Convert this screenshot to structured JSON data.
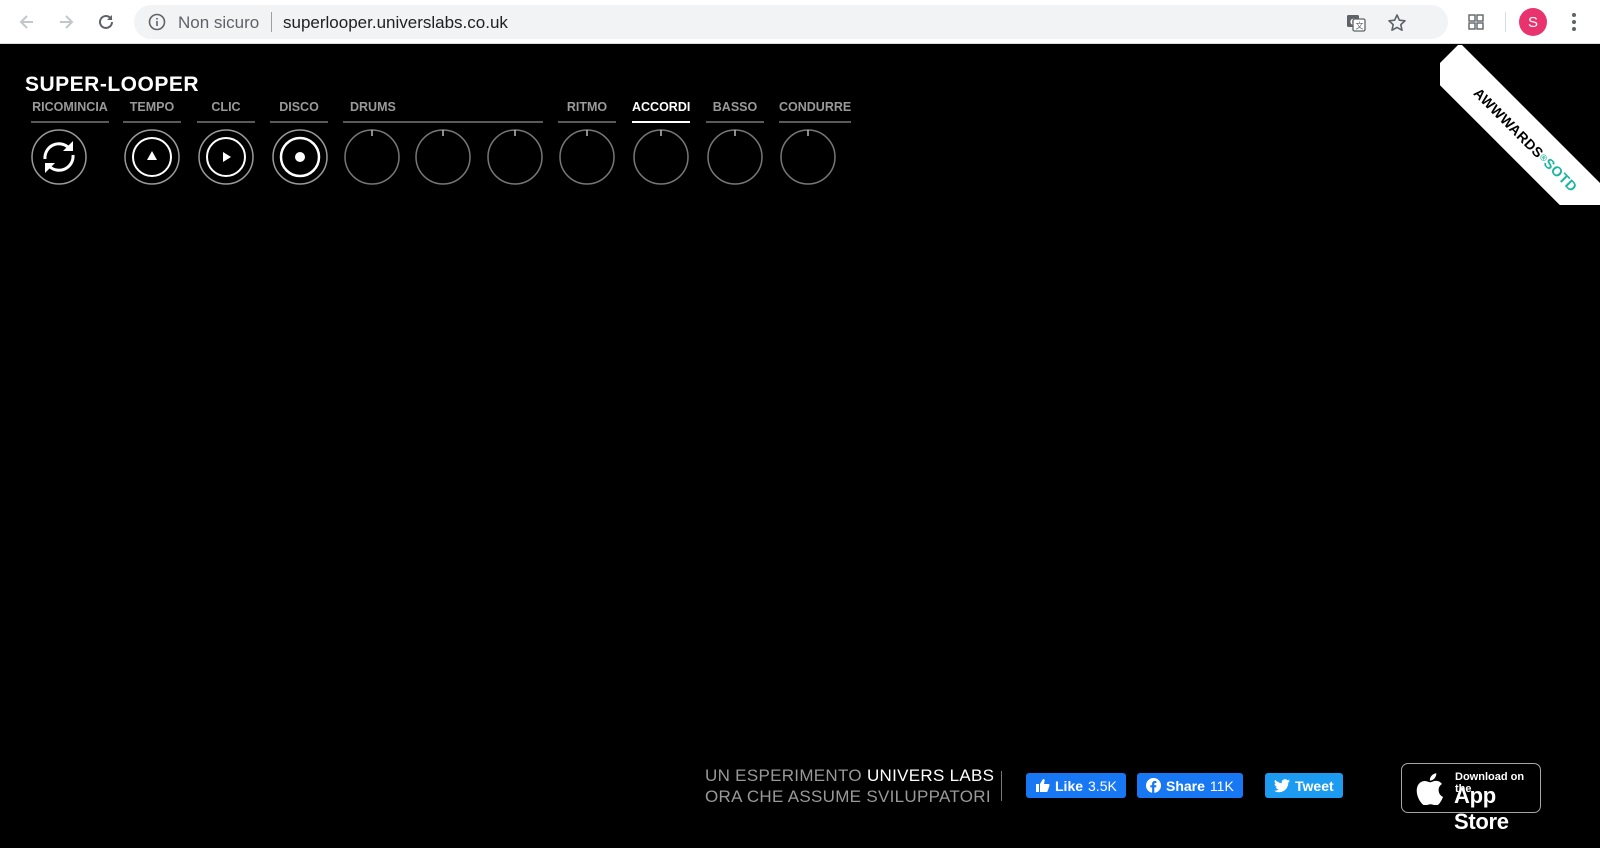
{
  "browser": {
    "security_label": "Non sicuro",
    "url": "superlooper.universlabs.co.uk",
    "avatar_letter": "S"
  },
  "app": {
    "logo": "SUPER-LOOPER"
  },
  "controls": [
    {
      "label": "RICOMINCIA",
      "icon": "refresh-icon",
      "active": false
    },
    {
      "label": "TEMPO",
      "icon": "tempo-triangle-icon",
      "active": false
    },
    {
      "label": "CLIC",
      "icon": "play-icon",
      "active": false
    },
    {
      "label": "DISCO",
      "icon": "record-dot-icon",
      "active": false
    },
    {
      "label": "DRUMS",
      "icon": "empty-loop-icon",
      "active": false
    },
    {
      "label": "RITMO",
      "icon": "empty-loop-icon",
      "active": false
    },
    {
      "label": "ACCORDI",
      "icon": "empty-loop-icon",
      "active": true
    },
    {
      "label": "BASSO",
      "icon": "empty-loop-icon",
      "active": false
    },
    {
      "label": "CONDURRE",
      "icon": "empty-loop-icon",
      "active": false
    }
  ],
  "ribbon": {
    "brand": "AWWWARDS",
    "reg": "®",
    "tag": "SOTD"
  },
  "footer": {
    "line1_prefix": "UN ESPERIMENTO",
    "line1_brand": "UNIVERS LABS",
    "line2": "ORA CHE ASSUME SVILUPPATORI",
    "like_label": "Like",
    "like_count": "3.5K",
    "share_label": "Share",
    "share_count": "11K",
    "tweet_label": "Tweet",
    "appstore_small": "Download on the",
    "appstore_big": "App Store"
  },
  "colors": {
    "background": "#000000",
    "ribbon_accent": "#1ab5a0",
    "facebook": "#1877f2",
    "twitter": "#1d9bf0"
  }
}
